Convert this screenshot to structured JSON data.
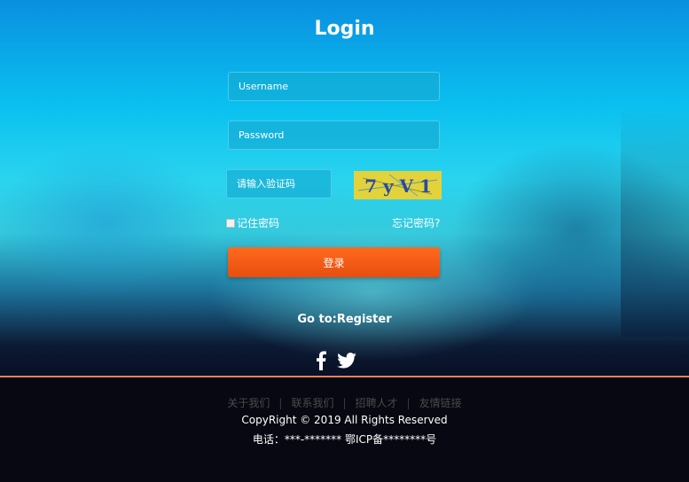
{
  "page": {
    "title": "Login"
  },
  "form": {
    "username_placeholder": "Username",
    "password_placeholder": "Password",
    "captcha_placeholder": "请输入验证码",
    "captcha_text": "7 y V 1",
    "remember_label": "记住密码",
    "forgot_label": "忘记密码?",
    "login_button": "登录",
    "register_link": "Go to:Register"
  },
  "social": {
    "icons": [
      "facebook-icon",
      "twitter-icon"
    ]
  },
  "footer": {
    "links": [
      "关于我们",
      "联系我们",
      "招聘人才",
      "友情链接"
    ],
    "separator": "|",
    "copyright": "CopyRight © 2019 All Rights Reserved",
    "contact": "电话：***-******* 鄂ICP备********号"
  },
  "colors": {
    "accent": "#f4561a",
    "field_bg": "#14aad2",
    "divider": "#e0845a",
    "footer_bg": "#080812"
  }
}
